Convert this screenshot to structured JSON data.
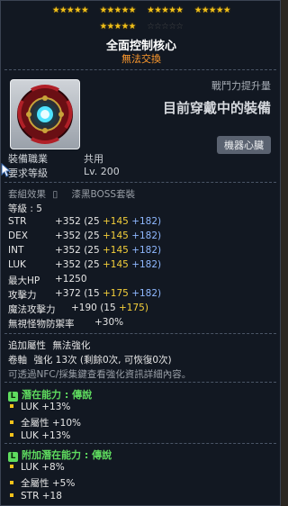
{
  "stars": {
    "row1": [
      "★★★★★",
      "★★★★★",
      "★★★★★",
      "★★★★★"
    ],
    "row2": [
      "★★★★★",
      "☆☆☆☆☆"
    ]
  },
  "item": {
    "name": "全面控制核心",
    "trade_status": "無法交換",
    "icon": "control-core-heart-icon"
  },
  "combat_power": {
    "label": "戰鬥力提升量",
    "value": "目前穿戴中的裝備"
  },
  "category_badge": "機器心臟",
  "info": {
    "job_label": "裝備職業",
    "job_value": "共用",
    "level_label": "要求等級",
    "level_value": "Lv. 200"
  },
  "set": {
    "label": "套組效果",
    "name": "漆黑BOSS套裝"
  },
  "stats": {
    "grade": "等級 : 5",
    "lines": [
      {
        "name": "STR",
        "base": "+352",
        "open": "(25",
        "plus1": "+145",
        "plus2": "+182)"
      },
      {
        "name": "DEX",
        "base": "+352",
        "open": "(25",
        "plus1": "+145",
        "plus2": "+182)"
      },
      {
        "name": "INT",
        "base": "+352",
        "open": "(25",
        "plus1": "+145",
        "plus2": "+182)"
      },
      {
        "name": "LUK",
        "base": "+352",
        "open": "(25",
        "plus1": "+145",
        "plus2": "+182)"
      }
    ],
    "hp_label": "最大HP",
    "hp_value": "+1250",
    "atk_label": "攻擊力",
    "atk_base": "+372",
    "atk_open": "(15",
    "atk_plus1": "+175",
    "atk_plus2": "+182)",
    "matk_label": "魔法攻擊力",
    "matk_base": "+190",
    "matk_open": "(15",
    "matk_plus1": "+175)",
    "ied_label": "無視怪物防禦率",
    "ied_value": "+30%"
  },
  "extra": {
    "attr_label": "追加屬性",
    "attr_value": "無法強化",
    "scroll_label": "卷軸",
    "scroll_value": "強化 13次 (剩餘0次, 可恢復0次)",
    "hint": "可透過NFC/採集鍵查看強化資訊詳細內容。"
  },
  "potential": {
    "tag": "L",
    "label": "潛在能力 :",
    "grade": "傳說",
    "lines": [
      "LUK +13%",
      "全屬性 +10%",
      "LUK +13%"
    ]
  },
  "bonus_potential": {
    "tag": "L",
    "label": "附加潛在能力 :",
    "grade": "傳說",
    "lines": [
      "LUK +8%",
      "全屬性 +5%",
      "STR +18"
    ]
  },
  "colors": {
    "star": "#f3c21a",
    "legendary": "#5fdc5f",
    "orange": "#ff9a2e",
    "blue": "#8fb8ff"
  }
}
